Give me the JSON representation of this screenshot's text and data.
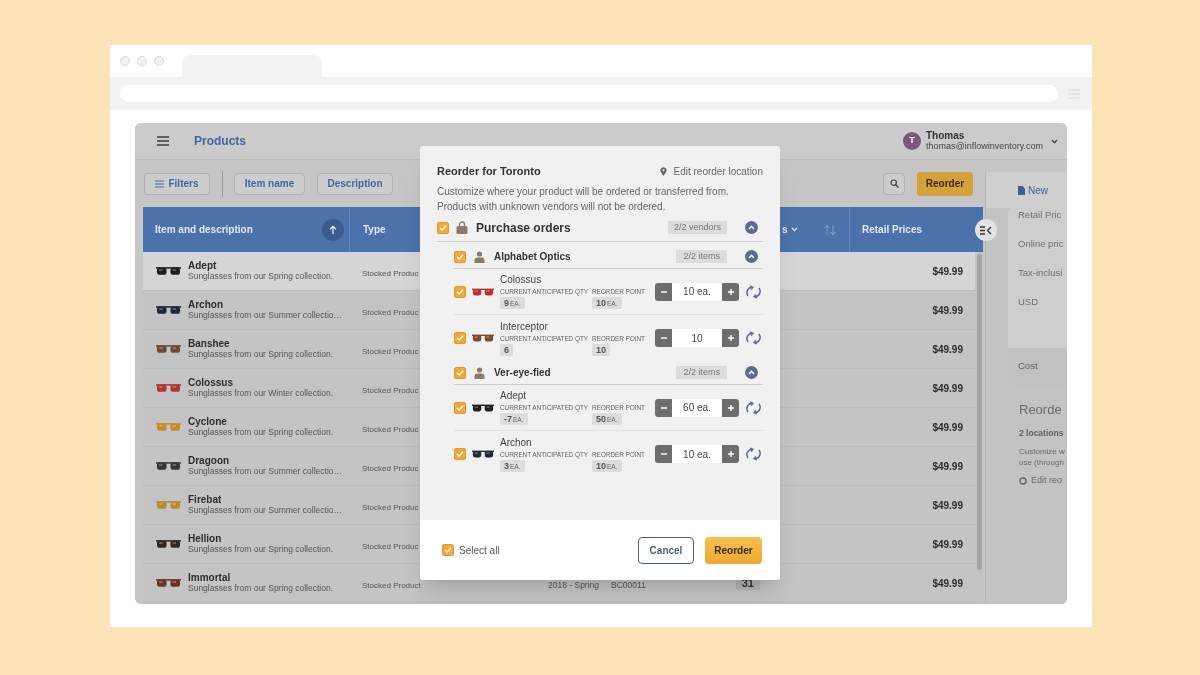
{
  "app": {
    "title": "Products",
    "user": {
      "initial": "T",
      "name": "Thomas",
      "email": "thomas@inflowinventory.com"
    }
  },
  "toolbar": {
    "filters": "Filters",
    "chips": [
      "Item name",
      "Description"
    ],
    "reorder": "Reorder"
  },
  "table": {
    "columns": [
      {
        "label": "Item and description",
        "sorted": true
      },
      {
        "label": "Type"
      },
      {
        "label": "s",
        "sorted": false
      },
      {
        "label": "Retail Prices"
      }
    ],
    "rows": [
      {
        "name": "Adept",
        "description": "Sunglasses from our Spring collection.",
        "type": "Stocked Produc",
        "price": "$49.99",
        "selected": true
      },
      {
        "name": "Archon",
        "description": "Sunglasses from our Summer collectio…",
        "type": "Stocked Produc",
        "price": "$49.99",
        "selected": false
      },
      {
        "name": "Banshee",
        "description": "Sunglasses from our Spring collection.",
        "type": "Stocked Produc",
        "price": "$49.99",
        "selected": false
      },
      {
        "name": "Colossus",
        "description": "Sunglasses from our Winter collection.",
        "type": "Stocked Produc",
        "price": "$49.99",
        "selected": false
      },
      {
        "name": "Cyclone",
        "description": "Sunglasses from our Spring collection.",
        "type": "Stocked Produc",
        "price": "$49.99",
        "selected": false
      },
      {
        "name": "Dragoon",
        "description": "Sunglasses from our Summer collectio…",
        "type": "Stocked Produc",
        "price": "$49.99",
        "selected": false
      },
      {
        "name": "Firebat",
        "description": "Sunglasses from our Summer collectio…",
        "type": "Stocked Produc",
        "price": "$49.99",
        "selected": false
      },
      {
        "name": "Hellion",
        "description": "Sunglasses from our Spring collection.",
        "type": "Stocked Produc",
        "price": "$49.99",
        "selected": false
      },
      {
        "name": "Immortal",
        "description": "Sunglasses from our Spring collection.",
        "type": "Stocked Product",
        "column_3": "2018 - Spring",
        "column_4": "BC00011",
        "column_5": "31",
        "price": "$49.99",
        "selected": false
      }
    ]
  },
  "side_panel": {
    "new_label": "New",
    "fields": [
      "Retail Pric",
      "Online pric",
      "Tax-inclusi",
      "USD"
    ],
    "cost_label": "Cost",
    "section_title": "Reorde",
    "locations": "2 locations",
    "note_lines": [
      "Customize w",
      "use (through"
    ],
    "link": "Edit reo"
  },
  "dialog": {
    "title": "Reorder for Toronto",
    "location_link": "Edit reorder location",
    "description": "Customize where your product will be ordered or transferred from. Products with unknown vendors will not be ordered.",
    "group": {
      "label": "Purchase orders",
      "checked": true,
      "count": "2/2 vendors",
      "expanded": true,
      "vendors": [
        {
          "name": "Alphabet Optics",
          "checked": true,
          "count": "2/2 items",
          "expanded": true,
          "items": [
            {
              "name": "Colossus",
              "checked": true,
              "qty_label": "CURRENT ANTICIPATED QTY",
              "qty": "9",
              "qty_unit": "EA.",
              "point_label": "REORDER POINT",
              "point": "10",
              "point_unit": "EA.",
              "quantity": "10 ea."
            },
            {
              "name": "Interceptor",
              "checked": true,
              "qty_label": "CURRENT ANTICIPATED QTY",
              "qty": "6",
              "point_label": "REORDER POINT",
              "point": "10",
              "quantity": "10"
            }
          ]
        },
        {
          "name": "Ver-eye-fied",
          "checked": true,
          "count": "2/2 items",
          "expanded": true,
          "items": [
            {
              "name": "Adept",
              "checked": true,
              "qty_label": "CURRENT ANTICIPATED QTY",
              "qty": "-7",
              "qty_unit": "EA.",
              "point_label": "REORDER POINT",
              "point": "50",
              "point_unit": "EA.",
              "quantity": "60 ea."
            },
            {
              "name": "Archon",
              "checked": true,
              "qty_label": "CURRENT ANTICIPATED QTY",
              "qty": "3",
              "qty_unit": "EA.",
              "point_label": "REORDER POINT",
              "point": "10",
              "point_unit": "EA.",
              "quantity": "10 ea."
            }
          ]
        }
      ]
    },
    "select_all": {
      "label": "Select all",
      "checked": true
    },
    "cancel": "Cancel",
    "confirm": "Reorder"
  }
}
